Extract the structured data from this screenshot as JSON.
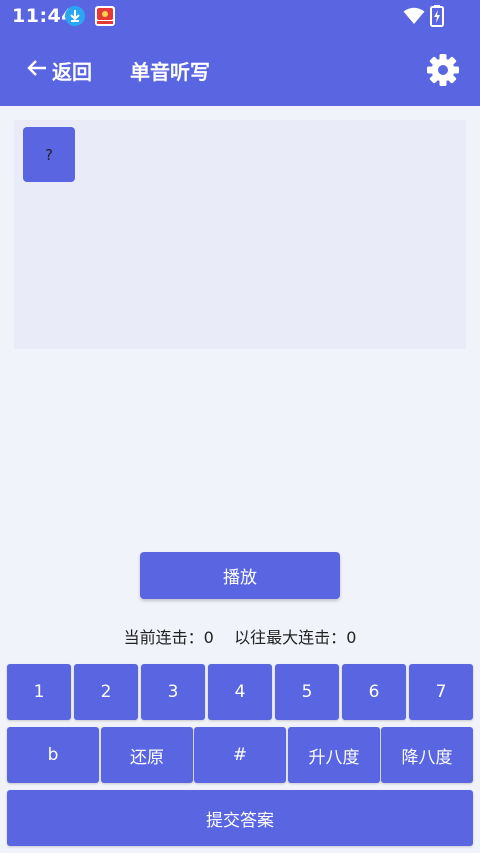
{
  "status_bar": {
    "time": "11:44",
    "icons": [
      "download-icon",
      "app-notification-icon",
      "wifi-icon",
      "battery-charging-icon"
    ]
  },
  "app_bar": {
    "back_label": "返回",
    "title": "单音听写",
    "icons": [
      "back-arrow-icon",
      "gear-icon"
    ]
  },
  "answer_area": {
    "slots": [
      "?"
    ]
  },
  "play_button": {
    "label": "播放"
  },
  "streak": {
    "current_label": "当前连击：",
    "current_value": "0",
    "best_label": "以往最大连击：",
    "best_value": "0"
  },
  "keyboard": {
    "numbers": [
      "1",
      "2",
      "3",
      "4",
      "5",
      "6",
      "7"
    ],
    "modifiers": [
      "b",
      "还原",
      "#",
      "升八度",
      "降八度"
    ],
    "submit_label": "提交答案"
  },
  "colors": {
    "primary": "#5a65e2",
    "background": "#f1f3fb",
    "answer_area": "#e9ecf8",
    "download_badge": "#2aa6f3"
  }
}
